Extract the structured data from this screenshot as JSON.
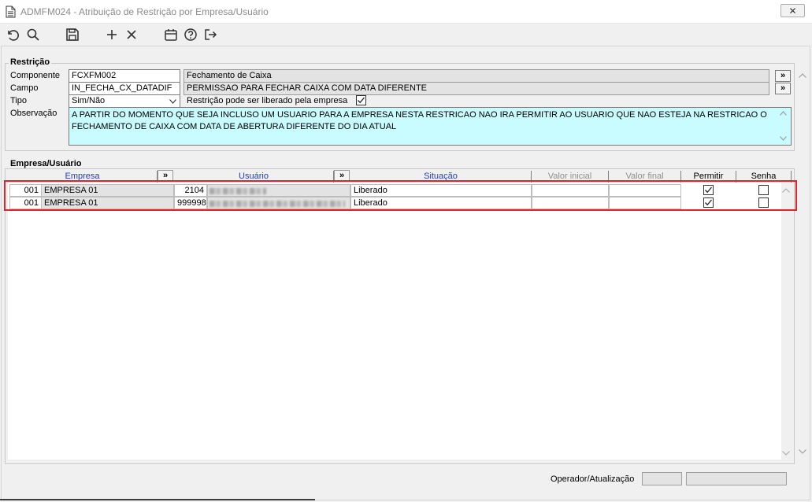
{
  "window": {
    "title": "ADMFM024 - Atribuição de Restrição por Empresa/Usuário",
    "close_glyph": "✕"
  },
  "toolbar": {
    "icons": [
      "undo-icon",
      "search-icon",
      "save-icon",
      "add-icon",
      "delete-icon",
      "calendar-icon",
      "help-icon",
      "exit-icon"
    ]
  },
  "restricao": {
    "legend": "Restrição",
    "componente_label": "Componente",
    "componente_code": "FCXFM002",
    "componente_desc": "Fechamento de Caixa",
    "campo_label": "Campo",
    "campo_code": "IN_FECHA_CX_DATADIF",
    "campo_desc": "PERMISSAO PARA FECHAR CAIXA COM DATA DIFERENTE",
    "tipo_label": "Tipo",
    "tipo_value": "Sim/Não",
    "liberado_label": "Restrição pode ser liberado pela empresa",
    "liberado_checked": true,
    "observacao_label": "Observação",
    "observacao_text": "A PARTIR DO MOMENTO QUE SEJA INCLUSO UM USUARIO PARA A EMPRESA NESTA RESTRICAO NAO IRA PERMITIR AO USUARIO QUE NAO ESTEJA NA RESTRICAO O FECHAMENTO DE CAIXA COM DATA DE ABERTURA DIFERENTE DO DIA ATUAL",
    "lookup_glyph": "»"
  },
  "empresa_usuario": {
    "legend": "Empresa/Usuário",
    "columns": {
      "empresa": "Empresa",
      "usuario": "Usuário",
      "situacao": "Situação",
      "valor_inicial": "Valor inicial",
      "valor_final": "Valor final",
      "permitir": "Permitir",
      "senha": "Senha"
    },
    "rows": [
      {
        "empresa_code": "001",
        "empresa_name": "EMPRESA 01",
        "usuario_code": "2104",
        "situacao": "Liberado",
        "permitir": true,
        "senha": false
      },
      {
        "empresa_code": "001",
        "empresa_name": "EMPRESA 01",
        "usuario_code": "999998",
        "situacao": "Liberado",
        "permitir": true,
        "senha": false
      }
    ]
  },
  "footer": {
    "operador_label": "Operador/Atualização"
  }
}
